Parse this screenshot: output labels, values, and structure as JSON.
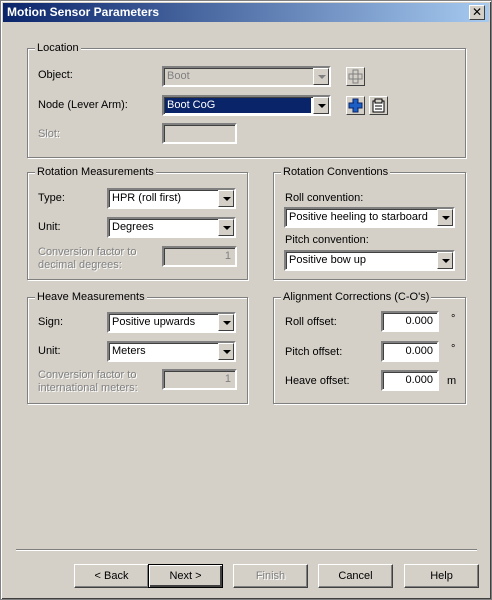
{
  "window": {
    "title": "Motion Sensor Parameters",
    "close_glyph": "✕"
  },
  "location": {
    "title": "Location",
    "object_label": "Object:",
    "object_value": "Boot",
    "node_label": "Node (Lever Arm):",
    "node_value": "Boot CoG",
    "slot_label": "Slot:",
    "slot_value": ""
  },
  "rotation_measurements": {
    "title": "Rotation Measurements",
    "type_label": "Type:",
    "type_value": "HPR (roll first)",
    "unit_label": "Unit:",
    "unit_value": "Degrees",
    "conversion_label_1": "Conversion factor to",
    "conversion_label_2": "decimal degrees:",
    "conversion_value": "1"
  },
  "rotation_conventions": {
    "title": "Rotation Conventions",
    "roll_label": "Roll convention:",
    "roll_value": "Positive heeling to starboard",
    "pitch_label": "Pitch convention:",
    "pitch_value": "Positive bow up"
  },
  "heave_measurements": {
    "title": "Heave Measurements",
    "sign_label": "Sign:",
    "sign_value": "Positive upwards",
    "unit_label": "Unit:",
    "unit_value": "Meters",
    "conversion_label_1": "Conversion factor to",
    "conversion_label_2": "international meters:",
    "conversion_value": "1"
  },
  "alignment_corrections": {
    "title": "Alignment Corrections (C-O's)",
    "roll_label": "Roll offset:",
    "roll_value": "0.000",
    "roll_unit": "°",
    "pitch_label": "Pitch offset:",
    "pitch_value": "0.000",
    "pitch_unit": "°",
    "heave_label": "Heave offset:",
    "heave_value": "0.000",
    "heave_unit": "m"
  },
  "buttons": {
    "back": "< Back",
    "next": "Next >",
    "finish": "Finish",
    "cancel": "Cancel",
    "help": "Help"
  },
  "colors": {
    "face": "#d4d0c8",
    "title_start": "#0a246a",
    "title_end": "#a6caf0",
    "selection": "#0a246a",
    "disabled_text": "#808080",
    "icon_blue": "#1c5fc4"
  },
  "icons": [
    "close-icon",
    "add-node-icon-disabled",
    "add-node-icon",
    "properties-icon",
    "chevron-down-icon"
  ]
}
